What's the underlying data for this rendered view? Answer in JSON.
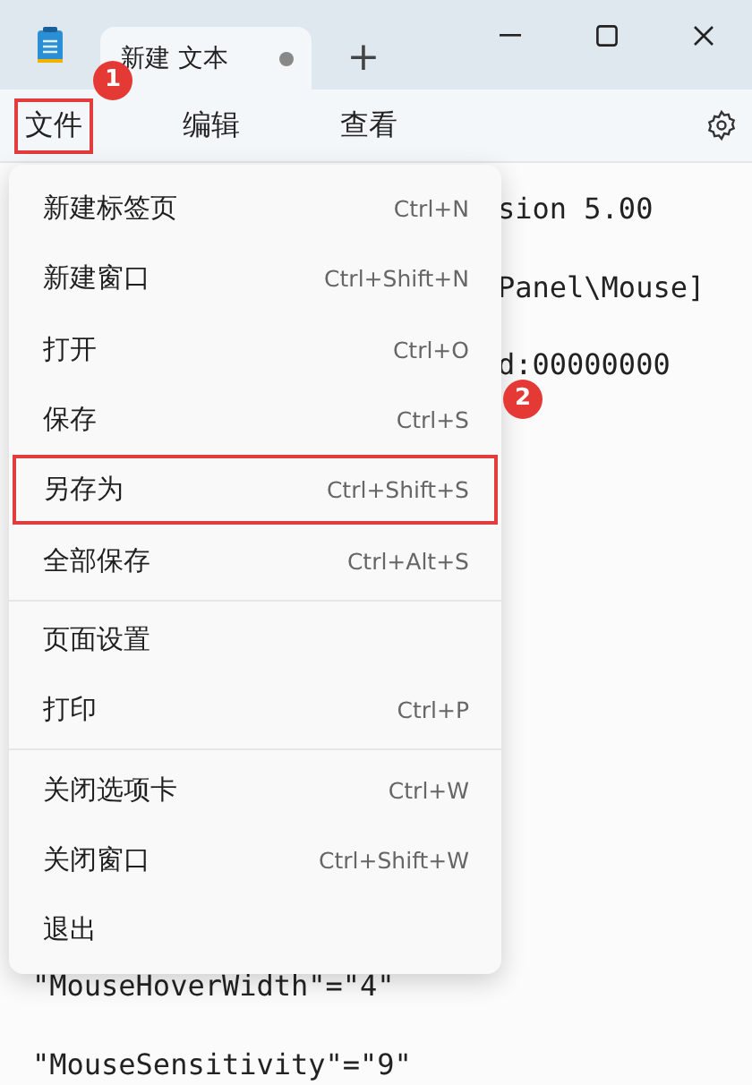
{
  "tabs": [
    {
      "title": "新建 文本",
      "modified": true,
      "selected": true
    }
  ],
  "new_tab_button": "+",
  "menu_bar": [
    {
      "label": "文件",
      "highlighted": true,
      "callout": "1"
    },
    {
      "label": "编辑",
      "highlighted": false
    },
    {
      "label": "查看",
      "highlighted": false
    }
  ],
  "file_menu": {
    "groups": [
      [
        {
          "label": "新建标签页",
          "shortcut": "Ctrl+N",
          "highlighted": false
        },
        {
          "label": "新建窗口",
          "shortcut": "Ctrl+Shift+N",
          "highlighted": false
        },
        {
          "label": "打开",
          "shortcut": "Ctrl+O",
          "highlighted": false
        },
        {
          "label": "保存",
          "shortcut": "Ctrl+S",
          "highlighted": false,
          "callout": "2"
        },
        {
          "label": "另存为",
          "shortcut": "Ctrl+Shift+S",
          "highlighted": true
        },
        {
          "label": "全部保存",
          "shortcut": "Ctrl+Alt+S",
          "highlighted": false
        }
      ],
      [
        {
          "label": "页面设置",
          "highlighted": false
        },
        {
          "label": "打印",
          "shortcut": "Ctrl+P",
          "highlighted": false
        }
      ],
      [
        {
          "label": "关闭选项卡",
          "shortcut": "Ctrl+W",
          "highlighted": false
        },
        {
          "label": "关闭窗口",
          "shortcut": "Ctrl+Shift+W",
          "highlighted": false
        },
        {
          "label": "退出",
          "highlighted": false
        }
      ]
    ]
  },
  "editor": {
    "top_lines": [
      {
        "text": "sion 5.00",
        "kind": "partial"
      },
      {
        "text": "Panel\\Mouse]",
        "kind": "partial"
      },
      {
        "text": "d:00000000",
        "kind": "partial"
      }
    ],
    "bottom_lines": [
      {
        "text": "\"MouseHoverWidth\"=\"4\""
      },
      {
        "text": "\"MouseSensitivity\"=\"9\""
      }
    ]
  }
}
